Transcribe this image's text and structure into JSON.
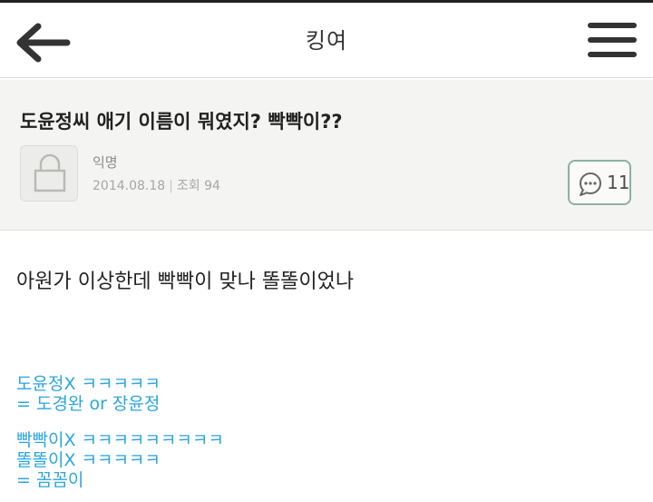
{
  "header": {
    "title": "킹여"
  },
  "post": {
    "title": "도윤정씨 애기 이름이 뭐였지? 빡빡이??",
    "author": "익명",
    "date": "2014.08.18",
    "views": "조회 94",
    "comment_count": "11"
  },
  "content": {
    "intro": "아원가 이상한데 빡빡이 맞나 똘똘이었나",
    "lines": [
      "도윤정X ㅋㅋㅋㅋㅋ",
      "= 도경완 or 장윤정",
      "빡빡이X ㅋㅋㅋㅋㅋㅋㅋㅋㅋ",
      "똘똘이X ㅋㅋㅋㅋㅋ",
      "= 꼼꼼이"
    ]
  },
  "colors": {
    "accent": "#2ba6dc",
    "comment_border": "#8db1a4"
  },
  "icons": {
    "back": "arrow-left-icon",
    "menu": "hamburger-menu-icon",
    "avatar": "lock-icon",
    "comment": "speech-bubble-icon"
  }
}
